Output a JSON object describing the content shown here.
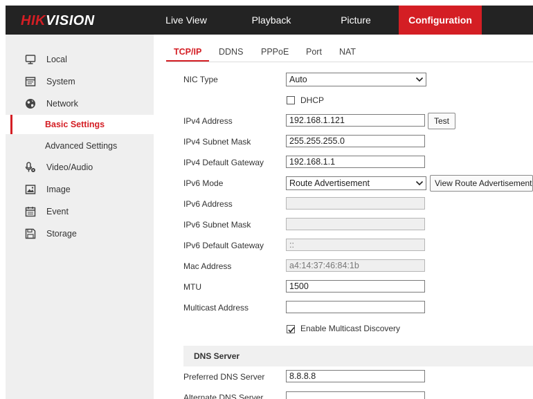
{
  "brand": {
    "logo_red": "HIK",
    "logo_white": "VISION",
    "accent": "#d41e24"
  },
  "topnav": {
    "live_view": "Live View",
    "playback": "Playback",
    "picture": "Picture",
    "configuration": "Configuration"
  },
  "sidebar": {
    "local": "Local",
    "system": "System",
    "network": "Network",
    "basic_settings": "Basic Settings",
    "advanced_settings": "Advanced Settings",
    "video_audio": "Video/Audio",
    "image": "Image",
    "event": "Event",
    "storage": "Storage"
  },
  "tabs": {
    "tcpip": "TCP/IP",
    "ddns": "DDNS",
    "pppoe": "PPPoE",
    "port": "Port",
    "nat": "NAT"
  },
  "form": {
    "nic_type_label": "NIC Type",
    "nic_type_value": "Auto",
    "dhcp_label": "DHCP",
    "dhcp_checked": false,
    "ipv4_address_label": "IPv4 Address",
    "ipv4_address_value": "192.168.1.121",
    "test_button": "Test",
    "ipv4_mask_label": "IPv4 Subnet Mask",
    "ipv4_mask_value": "255.255.255.0",
    "ipv4_gateway_label": "IPv4 Default Gateway",
    "ipv4_gateway_value": "192.168.1.1",
    "ipv6_mode_label": "IPv6 Mode",
    "ipv6_mode_value": "Route Advertisement",
    "view_route_button": "View Route Advertisement",
    "ipv6_address_label": "IPv6 Address",
    "ipv6_address_value": "",
    "ipv6_mask_label": "IPv6 Subnet Mask",
    "ipv6_mask_value": "",
    "ipv6_gateway_label": "IPv6 Default Gateway",
    "ipv6_gateway_value": "::",
    "mac_label": "Mac Address",
    "mac_value": "a4:14:37:46:84:1b",
    "mtu_label": "MTU",
    "mtu_value": "1500",
    "multicast_label": "Multicast Address",
    "multicast_value": "",
    "multicast_discovery_label": "Enable Multicast Discovery",
    "multicast_discovery_checked": true
  },
  "dns": {
    "header": "DNS Server",
    "preferred_label": "Preferred DNS Server",
    "preferred_value": "8.8.8.8",
    "alternate_label": "Alternate DNS Server",
    "alternate_value": ""
  }
}
